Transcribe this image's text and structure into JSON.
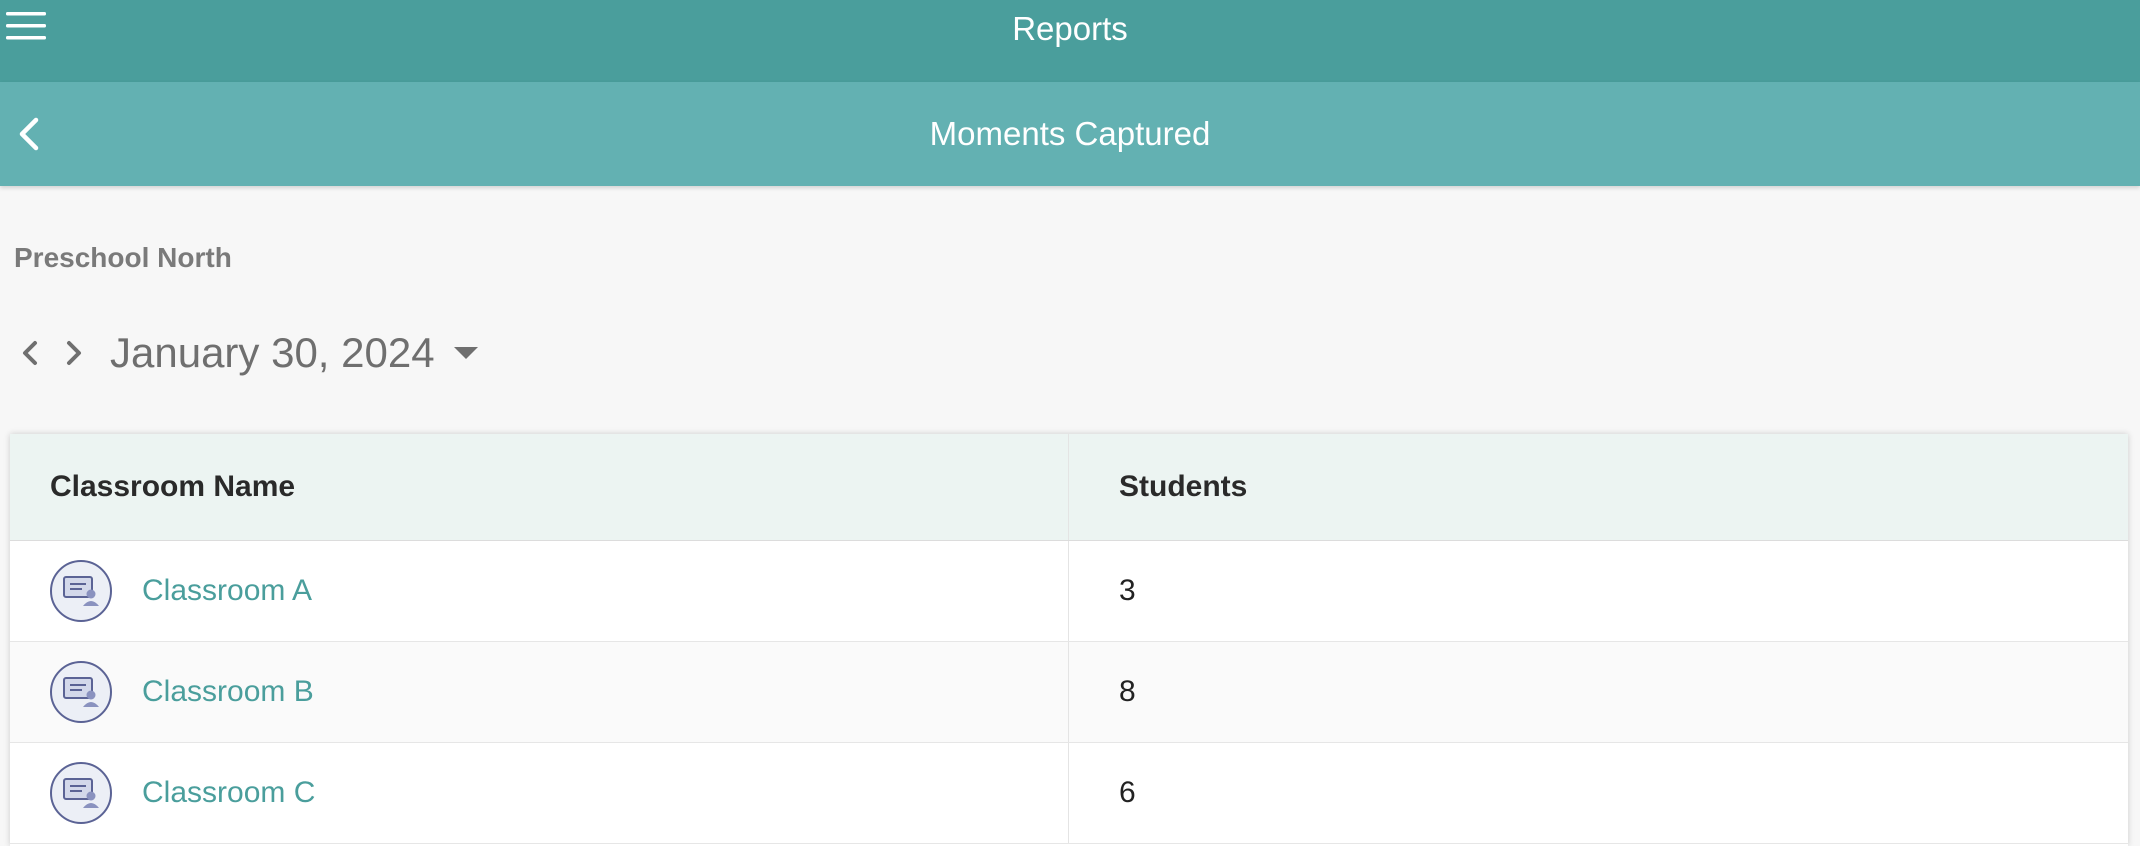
{
  "header": {
    "title": "Reports",
    "menu_icon": "hamburger-menu-icon"
  },
  "subheader": {
    "title": "Moments Captured",
    "back_icon": "chevron-left-icon"
  },
  "school": {
    "name": "Preschool North"
  },
  "date_picker": {
    "date": "January 30, 2024",
    "prev_icon": "chevron-left-icon",
    "next_icon": "chevron-right-icon",
    "dropdown_icon": "caret-down-icon"
  },
  "table": {
    "columns": [
      "Classroom Name",
      "Students"
    ],
    "rows": [
      {
        "name": "Classroom A",
        "students": "3"
      },
      {
        "name": "Classroom B",
        "students": "8"
      },
      {
        "name": "Classroom C",
        "students": "6"
      }
    ]
  },
  "colors": {
    "top_bar": "#4a9e9c",
    "sub_bar": "#63b1b2",
    "link": "#4a9e9c",
    "background": "#f7f7f7"
  }
}
